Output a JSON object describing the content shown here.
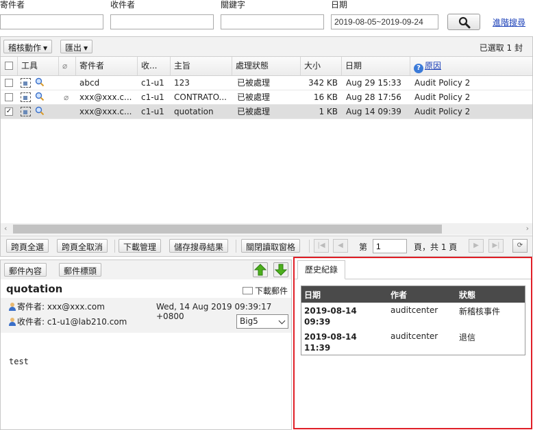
{
  "search": {
    "sender_label": "寄件者",
    "recipient_label": "收件者",
    "keyword_label": "關鍵字",
    "date_label": "日期",
    "date_value": "2019-08-05~2019-09-24",
    "advanced_link": "進階搜尋",
    "search_icon": "magnifier-icon"
  },
  "toolbar": {
    "audit_action": "稽核動作",
    "export": "匯出",
    "selected_count": "已選取 1 封"
  },
  "columns": {
    "tools": "工具",
    "sender": "寄件者",
    "recipient": "收YY",
    "subject": "主旨",
    "status": "處理狀態",
    "size": "大小",
    "date": "日期",
    "reason": "原因"
  },
  "rows": [
    {
      "checked": false,
      "attachment": false,
      "sender": "abcd",
      "recipient": "c1-u1",
      "subject": "123",
      "status": "已被處理",
      "size": "342 KB",
      "date": "Aug 29 15:33",
      "reason": "Audit Policy 2"
    },
    {
      "checked": false,
      "attachment": true,
      "sender": "xxx@xxx.c...",
      "recipient": "c1-u1",
      "subject": "CONTRATO...",
      "status": "已被處理",
      "size": "16 KB",
      "date": "Aug 28 17:56",
      "reason": "Audit Policy 2"
    },
    {
      "checked": true,
      "attachment": false,
      "sender": "xxx@xxx.c...",
      "recipient": "c1-u1",
      "subject": "quotation",
      "status": "已被處理",
      "size": "1 KB",
      "date": "Aug 14 09:39",
      "reason": "Audit Policy 2"
    }
  ],
  "bottom_toolbar": {
    "select_all_pages": "跨頁全選",
    "deselect_all_pages": "跨頁全取消",
    "download_manager": "下載管理",
    "save_search": "儲存搜尋結果",
    "close_reading_pane": "關閉讀取窗格",
    "page_label": "第",
    "page_value": "1",
    "page_total": "頁，共 1 頁"
  },
  "preview": {
    "tab_content": "郵件內容",
    "tab_header": "郵件標頭",
    "subject": "quotation",
    "download": "下載郵件",
    "sender_label": "寄件者:",
    "sender": "xxx@xxx.com",
    "recipient_label": "收件者:",
    "recipient": "c1-u1@lab210.com",
    "datetime": "Wed, 14 Aug 2019 09:39:17 +0800",
    "encoding": "Big5",
    "body": "test"
  },
  "history": {
    "tab": "歷史紀錄",
    "headers": {
      "date": "日期",
      "author": "作者",
      "status": "狀態"
    },
    "entries": [
      {
        "date_line1": "2019-08-14",
        "date_line2": "09:39",
        "author": "auditcenter",
        "status": "新稽核事件"
      },
      {
        "date_line1": "2019-08-14",
        "date_line2": "11:39",
        "author": "auditcenter",
        "status": "退信"
      }
    ]
  },
  "colors": {
    "highlight_border": "#e01e26",
    "link": "#1a3fb8",
    "history_header": "#4a4a4a",
    "selected_row": "#dedede"
  }
}
